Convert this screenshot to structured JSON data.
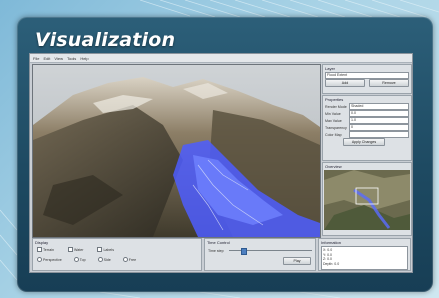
{
  "page": {
    "title": "Visualization"
  },
  "app": {
    "menu": [
      "File",
      "Edit",
      "View",
      "Tools",
      "Help"
    ],
    "right_panel": {
      "layer_group": {
        "title": "Layer",
        "select_value": "Flood Extent",
        "buttons": [
          "Add",
          "Remove"
        ]
      },
      "props_group": {
        "title": "Properties",
        "fields": [
          {
            "label": "Render Mode",
            "value": "Shaded"
          },
          {
            "label": "Min Value",
            "value": "0.0"
          },
          {
            "label": "Max Value",
            "value": "1.0"
          },
          {
            "label": "Transparency",
            "value": "0"
          },
          {
            "label": "Color Map",
            "value": ""
          }
        ],
        "apply_label": "Apply Changes"
      },
      "overview_title": "Overview"
    },
    "bottom": {
      "display_group": {
        "title": "Display",
        "checks": [
          "Terrain",
          "Water",
          "Labels"
        ],
        "radios": [
          "Perspective",
          "Top",
          "Side",
          "Free"
        ]
      },
      "time_group": {
        "title": "Time Control",
        "label": "Time step",
        "button": "Play"
      },
      "info_group": {
        "title": "Information",
        "lines": [
          "X: 0.0",
          "Y: 0.0",
          "Z: 0.0",
          "Depth: 0.0"
        ]
      }
    }
  }
}
